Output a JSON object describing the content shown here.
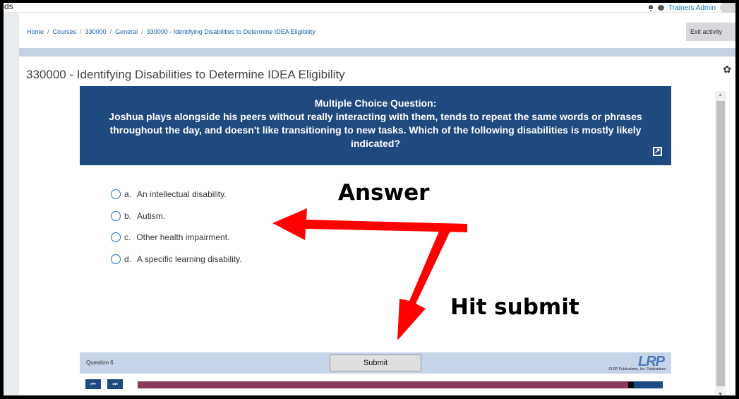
{
  "topbar": {
    "brand": "-ds",
    "user_name": "Trainers Admin"
  },
  "breadcrumb": {
    "items": [
      "Home",
      "Courses",
      "330000",
      "General",
      "330000 - Identifying Disabilities to Determine IDEA Eligibility"
    ],
    "separator": "/"
  },
  "exit_button": "Exit activity",
  "page": {
    "title": "330000 - Identifying Disabilities to Determine IDEA Eligibility"
  },
  "question": {
    "heading": "Multiple Choice Question:",
    "text": "Joshua plays alongside his peers without really interacting with them, tends to repeat the same words or phrases throughout the day, and doesn't like transitioning to new tasks. Which of the following disabilities is mostly likely indicated?",
    "options": [
      {
        "letter": "a.",
        "text": "An intellectual disability."
      },
      {
        "letter": "b.",
        "text": "Autism."
      },
      {
        "letter": "c.",
        "text": "Other health impairment."
      },
      {
        "letter": "d.",
        "text": "A specific learning disability."
      }
    ]
  },
  "player": {
    "question_label": "Question 6",
    "submit_label": "Submit",
    "logo_text": "LRP",
    "logo_sub": "©LRP Publications, Inc.   Publications",
    "prev_symbol": "⏮",
    "next_symbol": "⏭",
    "progress_fraction": 0.94
  },
  "annotations": {
    "answer": "Answer",
    "submit": "Hit submit",
    "arrow_color": "#ff0000"
  },
  "colors": {
    "banner": "#1e4a7f",
    "player_bar": "#c7d3e6",
    "progress": "#8a3a5a",
    "link": "#1a5fa8"
  }
}
